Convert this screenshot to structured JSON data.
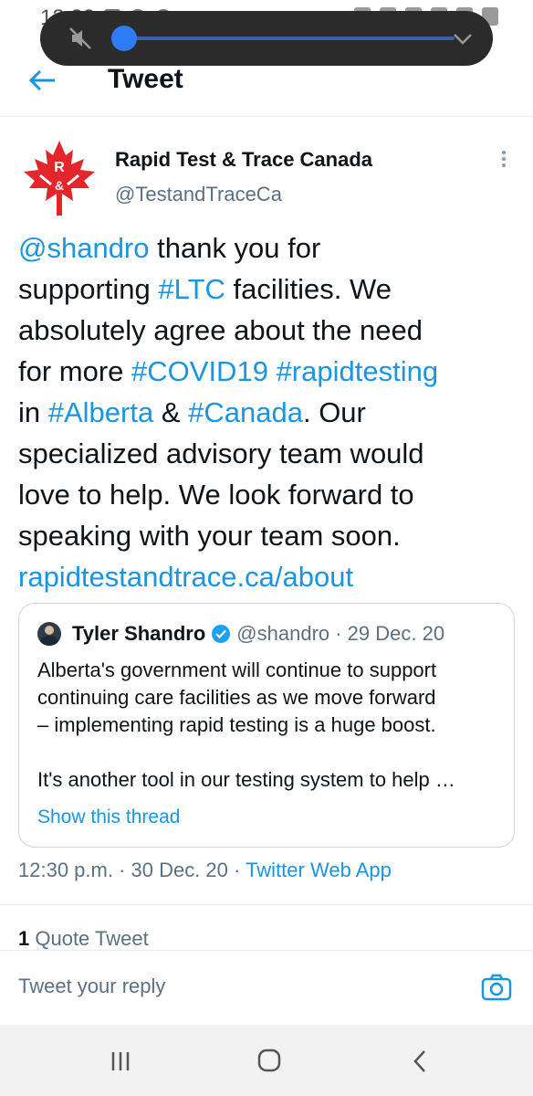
{
  "status_bar": {
    "time": "12:33"
  },
  "header": {
    "title": "Tweet"
  },
  "tweet": {
    "author_name": "Rapid Test & Trace Canada",
    "author_handle": "@TestandTraceCa",
    "lines": [
      [
        {
          "text": "@shandro",
          "link": true
        },
        {
          "text": " thank you for",
          "link": false
        }
      ],
      [
        {
          "text": "supporting ",
          "link": false
        },
        {
          "text": "#LTC",
          "link": true
        },
        {
          "text": " facilities. We",
          "link": false
        }
      ],
      [
        {
          "text": "absolutely agree about the need",
          "link": false
        }
      ],
      [
        {
          "text": "for more ",
          "link": false
        },
        {
          "text": "#COVID19",
          "link": true
        },
        {
          "text": " ",
          "link": false
        },
        {
          "text": "#rapidtesting",
          "link": true
        }
      ],
      [
        {
          "text": "in ",
          "link": false
        },
        {
          "text": "#Alberta",
          "link": true
        },
        {
          "text": " & ",
          "link": false
        },
        {
          "text": "#Canada",
          "link": true
        },
        {
          "text": ". Our",
          "link": false
        }
      ],
      [
        {
          "text": "specialized advisory team would",
          "link": false
        }
      ],
      [
        {
          "text": "love to help. We look forward to",
          "link": false
        }
      ],
      [
        {
          "text": "speaking with your team soon.",
          "link": false
        }
      ],
      [
        {
          "text": "rapidtestandtrace.ca/about",
          "link": true
        }
      ]
    ],
    "timestamp": "12:30 p.m. · 30 Dec. 20 · ",
    "source": "Twitter Web App"
  },
  "quoted_tweet": {
    "author_name": "Tyler Shandro",
    "meta": "@shandro · 29 Dec. 20",
    "lines": [
      "Alberta's government will continue to support",
      "continuing care facilities as we move forward",
      "– implementing rapid testing is a huge boost."
    ],
    "lines_2": [
      "It's another tool in our testing system to help …"
    ],
    "show_thread": "Show this thread"
  },
  "engagement": {
    "quote_count": "1",
    "quote_label": " Quote Tweet"
  },
  "reply": {
    "placeholder": "Tweet your reply"
  },
  "colors": {
    "link": "#1b95e0",
    "brand_red": "#e3262c",
    "secondary_text": "#5b7083"
  }
}
